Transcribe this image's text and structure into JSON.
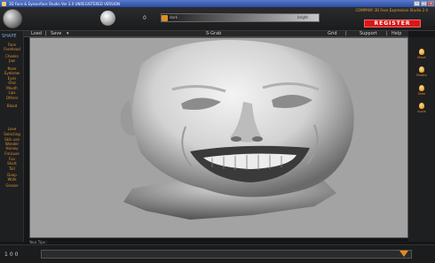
{
  "window": {
    "title": "3D Face & Eyesurface Studio Ver 2.0   UNREGISTERED VERSION"
  },
  "topbar": {
    "company": "COMPANY 3D Face Expression Studio 2.0",
    "light_value": "0",
    "slider": {
      "dark_label": "dark",
      "bright_label": "bright",
      "value_fraction": 0.0
    },
    "register_label": "REGISTER"
  },
  "menubar": {
    "load": "Load",
    "save": "Save",
    "sgrab": "S-Grab",
    "grid": "Grid",
    "support": "Support",
    "help": "Help"
  },
  "sidebar": {
    "title": "SHAPE",
    "items": [
      {
        "label": "Face"
      },
      {
        "label": "Forehead"
      },
      {
        "label": "Cheeks"
      },
      {
        "label": "Jaw"
      },
      {
        "label": "Nose"
      },
      {
        "label": "Eyebrow"
      },
      {
        "label": "Eyes"
      },
      {
        "label": "Oral"
      },
      {
        "label": "Mouth"
      },
      {
        "label": "Lips"
      },
      {
        "label": "Others"
      },
      {
        "label": "Blood"
      },
      {
        "label": "Love"
      },
      {
        "label": "Selecting"
      },
      {
        "label": "Skin use"
      },
      {
        "label": "Wonder"
      },
      {
        "label": "Horsey"
      },
      {
        "label": "Fmisuse"
      },
      {
        "label": "Fun"
      },
      {
        "label": "Short"
      },
      {
        "label": "Tall"
      },
      {
        "label": "Doop"
      },
      {
        "label": "Wide"
      },
      {
        "label": "Grease"
      }
    ]
  },
  "rightbar": {
    "tools": [
      {
        "label": "Move",
        "icon": "bulb-icon"
      },
      {
        "label": "Rotate",
        "icon": "bulb-icon"
      },
      {
        "label": "Slide",
        "icon": "bulb-icon"
      },
      {
        "label": "Scale",
        "icon": "bulb-icon"
      }
    ]
  },
  "statusbar": {
    "tips_label": "Your Tips :",
    "zoom": "100"
  }
}
